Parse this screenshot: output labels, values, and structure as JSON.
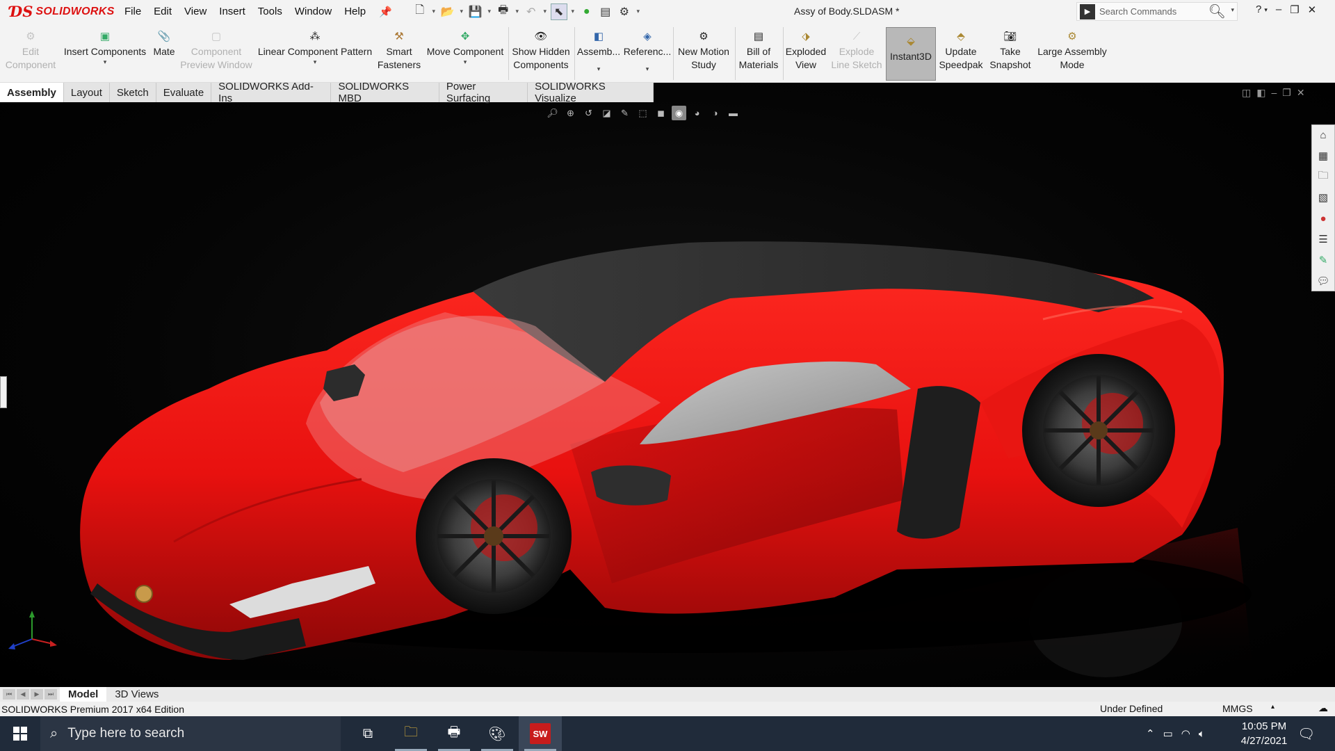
{
  "app": {
    "logo_mark": "ƊS",
    "logo_text": "SOLIDWORKS",
    "document_title": "Assy of Body.SLDASM *"
  },
  "menu": [
    "File",
    "Edit",
    "View",
    "Insert",
    "Tools",
    "Window",
    "Help"
  ],
  "search": {
    "placeholder": "Search Commands"
  },
  "command_manager": {
    "edit_component": "Edit\nComponent",
    "insert_components": "Insert Components",
    "mate": "Mate",
    "component_preview_window": "Component\nPreview Window",
    "linear_component_pattern": "Linear Component Pattern",
    "smart_fasteners": "Smart\nFasteners",
    "move_component": "Move Component",
    "show_hidden_components": "Show Hidden\nComponents",
    "assembly_features": "Assemb...",
    "reference_geometry": "Referenc...",
    "new_motion_study": "New Motion\nStudy",
    "bill_of_materials": "Bill of\nMaterials",
    "exploded_view": "Exploded\nView",
    "explode_line_sketch": "Explode\nLine Sketch",
    "instant3d": "Instant3D",
    "update_speedpak": "Update\nSpeedpak",
    "take_snapshot": "Take\nSnapshot",
    "large_assembly_mode": "Large Assembly\nMode"
  },
  "tabs": [
    "Assembly",
    "Layout",
    "Sketch",
    "Evaluate",
    "SOLIDWORKS Add-Ins",
    "SOLIDWORKS MBD",
    "Power Surfacing",
    "SOLIDWORKS Visualize"
  ],
  "model_tabs": [
    "Model",
    "3D Views"
  ],
  "status": {
    "edition": "SOLIDWORKS Premium 2017 x64 Edition",
    "definition": "Under Defined",
    "units": "MMGS"
  },
  "taskbar": {
    "search_placeholder": "Type here to search",
    "time": "10:05 PM",
    "date": "4/27/2021",
    "solidworks_badge": "SW"
  },
  "colors": {
    "car_body": "#e8110f",
    "brand_red": "#d11111",
    "taskbar": "#202b3a"
  },
  "icons": [
    "search-icon",
    "help-icon",
    "minimize-icon",
    "restore-icon",
    "close-icon",
    "home-icon",
    "windows-start-icon",
    "file-explorer-icon"
  ]
}
